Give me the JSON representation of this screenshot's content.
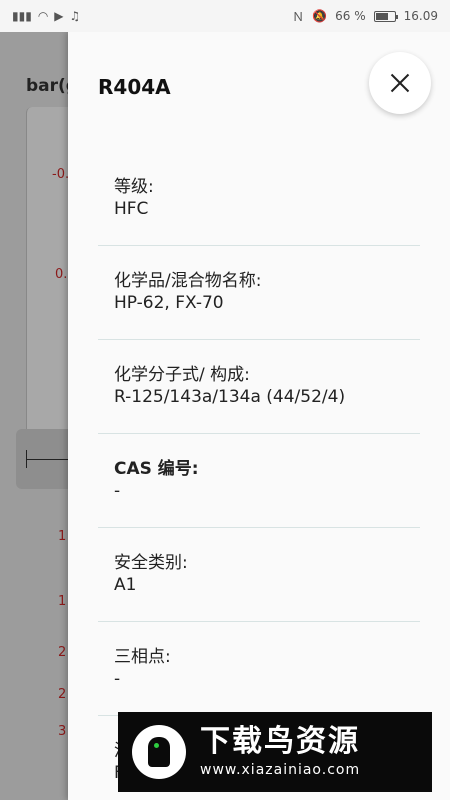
{
  "status_bar": {
    "battery": "66 %",
    "battery_level": 0.66,
    "time": "16.09"
  },
  "background": {
    "title": "bar(g",
    "values": [
      "-0.",
      "0.",
      "1",
      "1",
      "2",
      "2",
      "3"
    ]
  },
  "panel": {
    "title": "R404A",
    "properties": [
      {
        "label": "等级:",
        "value": "HFC"
      },
      {
        "label": "化学品/混合物名称:",
        "value": "HP-62, FX-70"
      },
      {
        "label": "化学分子式/ 构成:",
        "value": "R-125/143a/134a (44/52/4)"
      },
      {
        "label": "CAS 编号:",
        "value": "-"
      },
      {
        "label": "安全类别:",
        "value": "A1"
      },
      {
        "label": "三相点:",
        "value": "-"
      },
      {
        "label": "沸",
        "value": "F"
      }
    ]
  },
  "watermark": {
    "brand": "下载鸟资源",
    "url": "www.xiazainiao.com"
  }
}
